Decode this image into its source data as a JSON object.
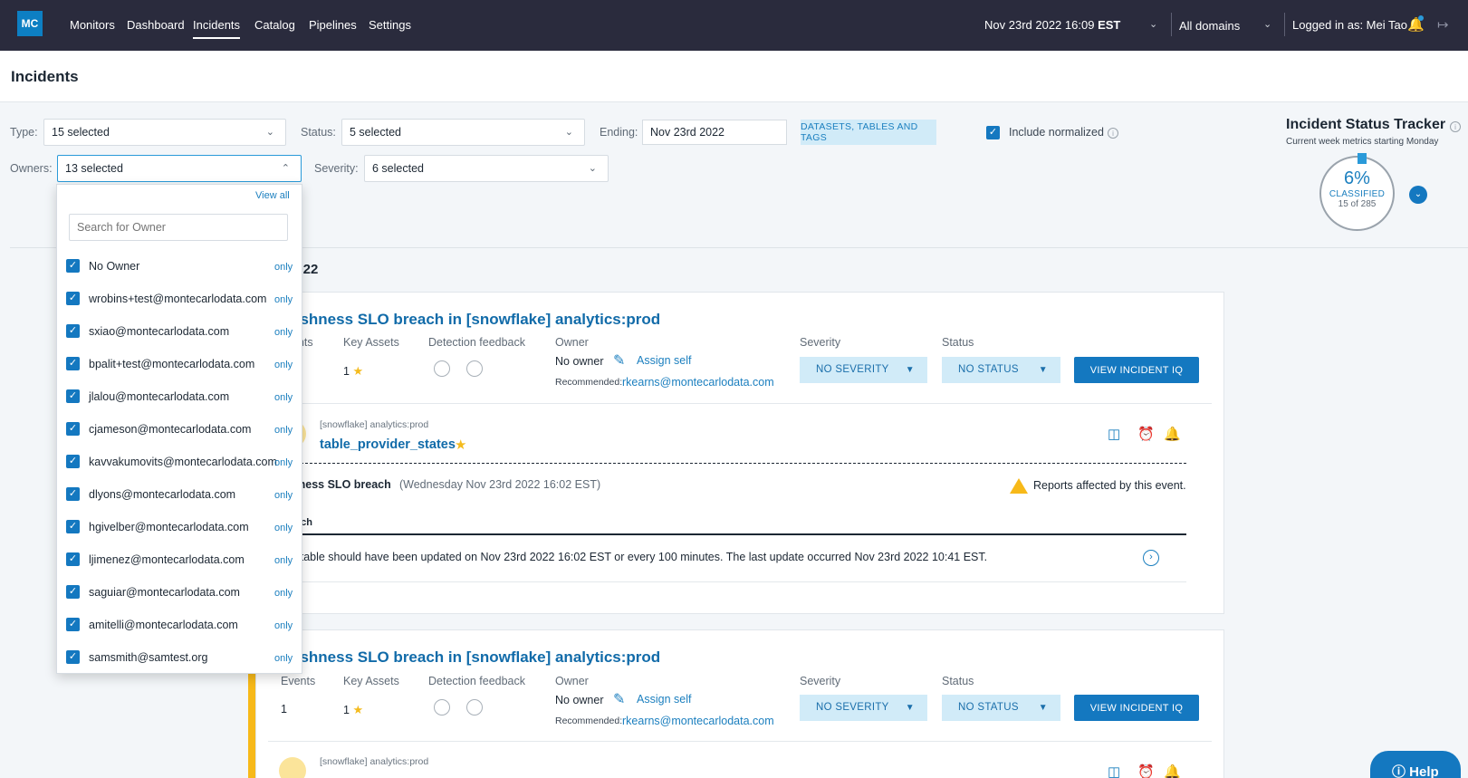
{
  "nav": {
    "logo": "MC",
    "links": [
      "Monitors",
      "Dashboard",
      "Incidents",
      "Catalog",
      "Pipelines",
      "Settings"
    ],
    "datetime": "Nov 23rd 2022 16:09",
    "timezone": "EST",
    "domains": "All domains",
    "logged_in": "Logged in as: Mei Tao"
  },
  "page": {
    "title": "Incidents"
  },
  "filters": {
    "type_label": "Type:",
    "type_value": "15 selected",
    "status_label": "Status:",
    "status_value": "5 selected",
    "ending_label": "Ending:",
    "ending_value": "Nov 23rd 2022",
    "datasets_button": "DATASETS, TABLES AND TAGS",
    "include_normalized": "Include normalized",
    "owners_label": "Owners:",
    "owners_value": "13 selected",
    "severity_label": "Severity:",
    "severity_value": "6 selected"
  },
  "owners_dropdown": {
    "view_all": "View all",
    "search_placeholder": "Search for Owner",
    "only_label": "only",
    "items": [
      "No Owner",
      "wrobins+test@montecarlodata.com",
      "sxiao@montecarlodata.com",
      "bpalit+test@montecarlodata.com",
      "jlalou@montecarlodata.com",
      "cjameson@montecarlodata.com",
      "kavvakumovits@montecarlodata.com",
      "dlyons@montecarlodata.com",
      "hgivelber@montecarlodata.com",
      "ljimenez@montecarlodata.com",
      "saguiar@montecarlodata.com",
      "amitelli@montecarlodata.com",
      "samsmith@samtest.org"
    ]
  },
  "tracker": {
    "title": "Incident Status Tracker",
    "subtitle": "Current week metrics starting Monday",
    "percent": "6%",
    "classified": "CLASSIFIED",
    "count": "15 of 285"
  },
  "day_heading": "2022",
  "incidents": [
    {
      "title": "eshness SLO breach in [snowflake] analytics:prod",
      "events_label": "ents",
      "events_value": "",
      "key_assets_label": "Key Assets",
      "key_assets_value": "1",
      "detection_label": "Detection feedback",
      "owner_label": "Owner",
      "owner_value": "No owner",
      "assign_self": "Assign self",
      "recommended_label": "Recommended:",
      "recommended_email": "rkearns@montecarlodata.com",
      "severity_label": "Severity",
      "severity_value": "NO SEVERITY",
      "status_label": "Status",
      "status_value": "NO STATUS",
      "view_button": "VIEW INCIDENT IQ",
      "asset_source": "[snowflake] analytics:prod",
      "asset_name": "table_provider_states",
      "event_title": "hness SLO breach",
      "event_time": "(Wednesday Nov 23rd 2022 16:02 EST)",
      "reports_affected": "Reports affected by this event.",
      "col_header": "ach",
      "description": "s table should have been updated on Nov 23rd 2022 16:02 EST or every 100 minutes. The last update occurred Nov 23rd 2022 10:41 EST."
    },
    {
      "title": "eshness SLO breach in [snowflake] analytics:prod",
      "events_label": "Events",
      "events_value": "1",
      "key_assets_label": "Key Assets",
      "key_assets_value": "1",
      "detection_label": "Detection feedback",
      "owner_label": "Owner",
      "owner_value": "No owner",
      "assign_self": "Assign self",
      "recommended_label": "Recommended:",
      "recommended_email": "rkearns@montecarlodata.com",
      "severity_label": "Severity",
      "severity_value": "NO SEVERITY",
      "status_label": "Status",
      "status_value": "NO STATUS",
      "view_button": "VIEW INCIDENT IQ",
      "asset_source": "[snowflake] analytics:prod"
    }
  ],
  "help": "Help",
  "colors": {
    "nav_bg": "#2a2b3d",
    "accent": "#1478c0",
    "link": "#116ba9",
    "warning": "#f7b919"
  }
}
